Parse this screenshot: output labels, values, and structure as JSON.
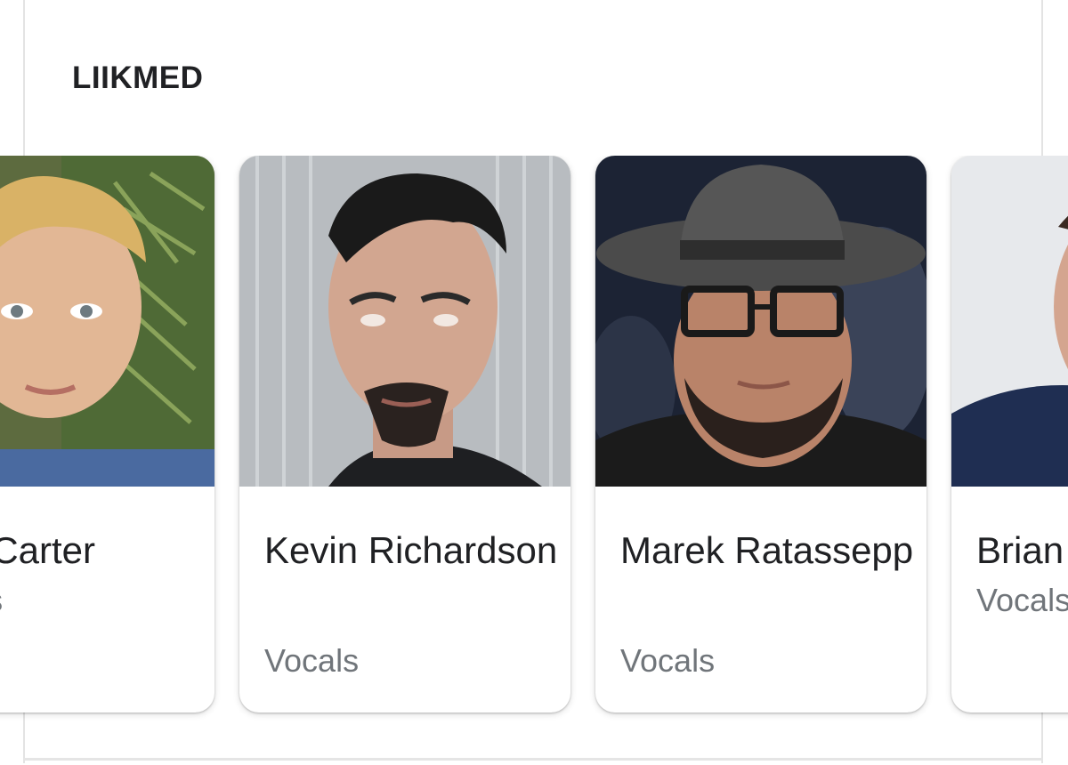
{
  "section": {
    "title": "LIIKMED"
  },
  "members": [
    {
      "name": "Nick Carter",
      "role": "Vocals"
    },
    {
      "name": "Kevin Richardson",
      "role": "Vocals"
    },
    {
      "name": "Marek Ratassepp",
      "role": "Vocals"
    },
    {
      "name": "Brian",
      "role": "Vocals"
    }
  ],
  "colors": {
    "title": "#202124",
    "name": "#202124",
    "role": "#70757a",
    "card_border": "#e3e3e3"
  }
}
